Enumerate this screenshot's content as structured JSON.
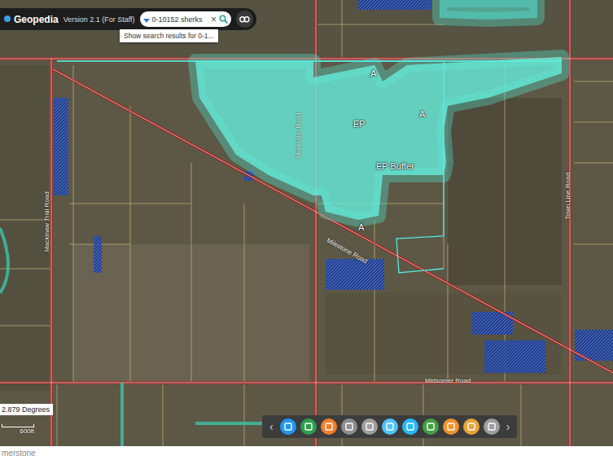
{
  "app": {
    "logo": "Geopedia",
    "version": "Version 2.1 (For Staff)"
  },
  "search": {
    "value": "0-10152 sherks",
    "clear": "×",
    "suggestion": "Show search results for 0-1..."
  },
  "map": {
    "labels": [
      {
        "text": "EP"
      },
      {
        "text": "EP Buffer"
      },
      {
        "text": "A"
      },
      {
        "text": "A"
      },
      {
        "text": "A"
      }
    ],
    "roads": [
      {
        "text": "Montcalm Road"
      },
      {
        "text": "Milestone Road"
      },
      {
        "text": "Midsomer Road"
      },
      {
        "text": "Mackinaw Trail Road"
      },
      {
        "text": "Town Line Road"
      }
    ]
  },
  "scale": {
    "rotation": "2.879 Degrees",
    "distance": "600ft"
  },
  "toolbar": {
    "prev": "‹",
    "next": "›",
    "tools": [
      {
        "color": "#2196f3"
      },
      {
        "color": "#2e9e4f"
      },
      {
        "color": "#f07f2a"
      },
      {
        "color": "#8d8d8d"
      },
      {
        "color": "#9e9e9e"
      },
      {
        "color": "#4fc3f7"
      },
      {
        "color": "#29b6f6"
      },
      {
        "color": "#43a047"
      },
      {
        "color": "#f0932b"
      },
      {
        "color": "#e8a33a"
      },
      {
        "color": "#9e9e9e"
      }
    ]
  },
  "footer": "merstone"
}
